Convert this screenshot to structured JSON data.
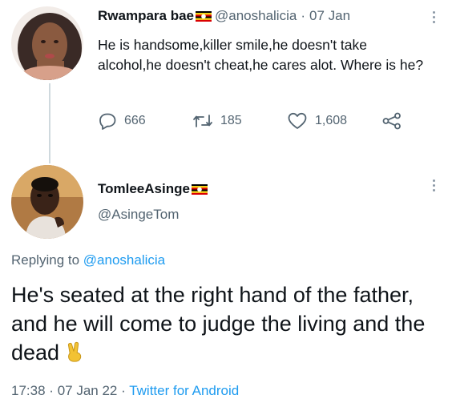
{
  "tweet": {
    "display_name": "Rwampara bae",
    "name_flag_icon": "uganda-flag-icon",
    "handle": "@anoshalicia",
    "separator": "·",
    "date": "07 Jan",
    "text": "He is handsome,killer smile,he doesn't take alcohol,he doesn't cheat,he cares alot. Where is he?",
    "actions": {
      "replies": "666",
      "retweets": "185",
      "likes": "1,608"
    }
  },
  "reply": {
    "display_name": "TomleeAsinge",
    "name_flag_icon": "uganda-flag-icon",
    "handle": "@AsingeTom",
    "replying_prefix": "Replying to",
    "replying_to": "@anoshalicia",
    "text": "He's seated at the right hand of the father, and he will come to judge the living and the dead",
    "emoji_icon": "victory-hand-icon",
    "footer": {
      "time": "17:38",
      "sep1": "·",
      "date": "07 Jan 22",
      "sep2": "·",
      "app": "Twitter for Android"
    }
  },
  "colors": {
    "text": "#0f1419",
    "secondary": "#536471",
    "link": "#1d9bf0",
    "thread_line": "#cfd9de"
  }
}
